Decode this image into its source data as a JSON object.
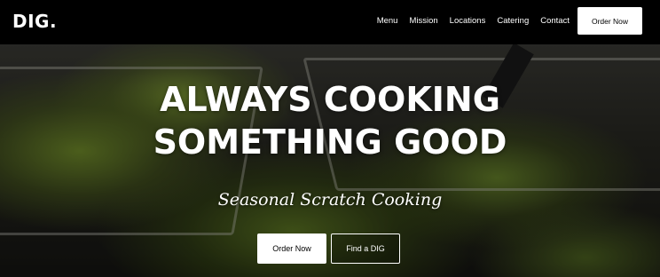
{
  "nav": {
    "logo": "DIG.",
    "links": [
      {
        "label": "Menu"
      },
      {
        "label": "Mission"
      },
      {
        "label": "Locations"
      },
      {
        "label": "Catering"
      },
      {
        "label": "Contact"
      }
    ],
    "order_label": "Order Now"
  },
  "hero": {
    "headline_line1": "ALWAYS COOKING",
    "headline_line2": "SOMETHING GOOD",
    "tagline": "Seasonal Scratch Cooking",
    "primary_label": "Order Now",
    "secondary_label": "Find a DIG"
  },
  "colors": {
    "nav_bg": "#000000",
    "button_bg": "#ffffff",
    "text": "#ffffff"
  }
}
